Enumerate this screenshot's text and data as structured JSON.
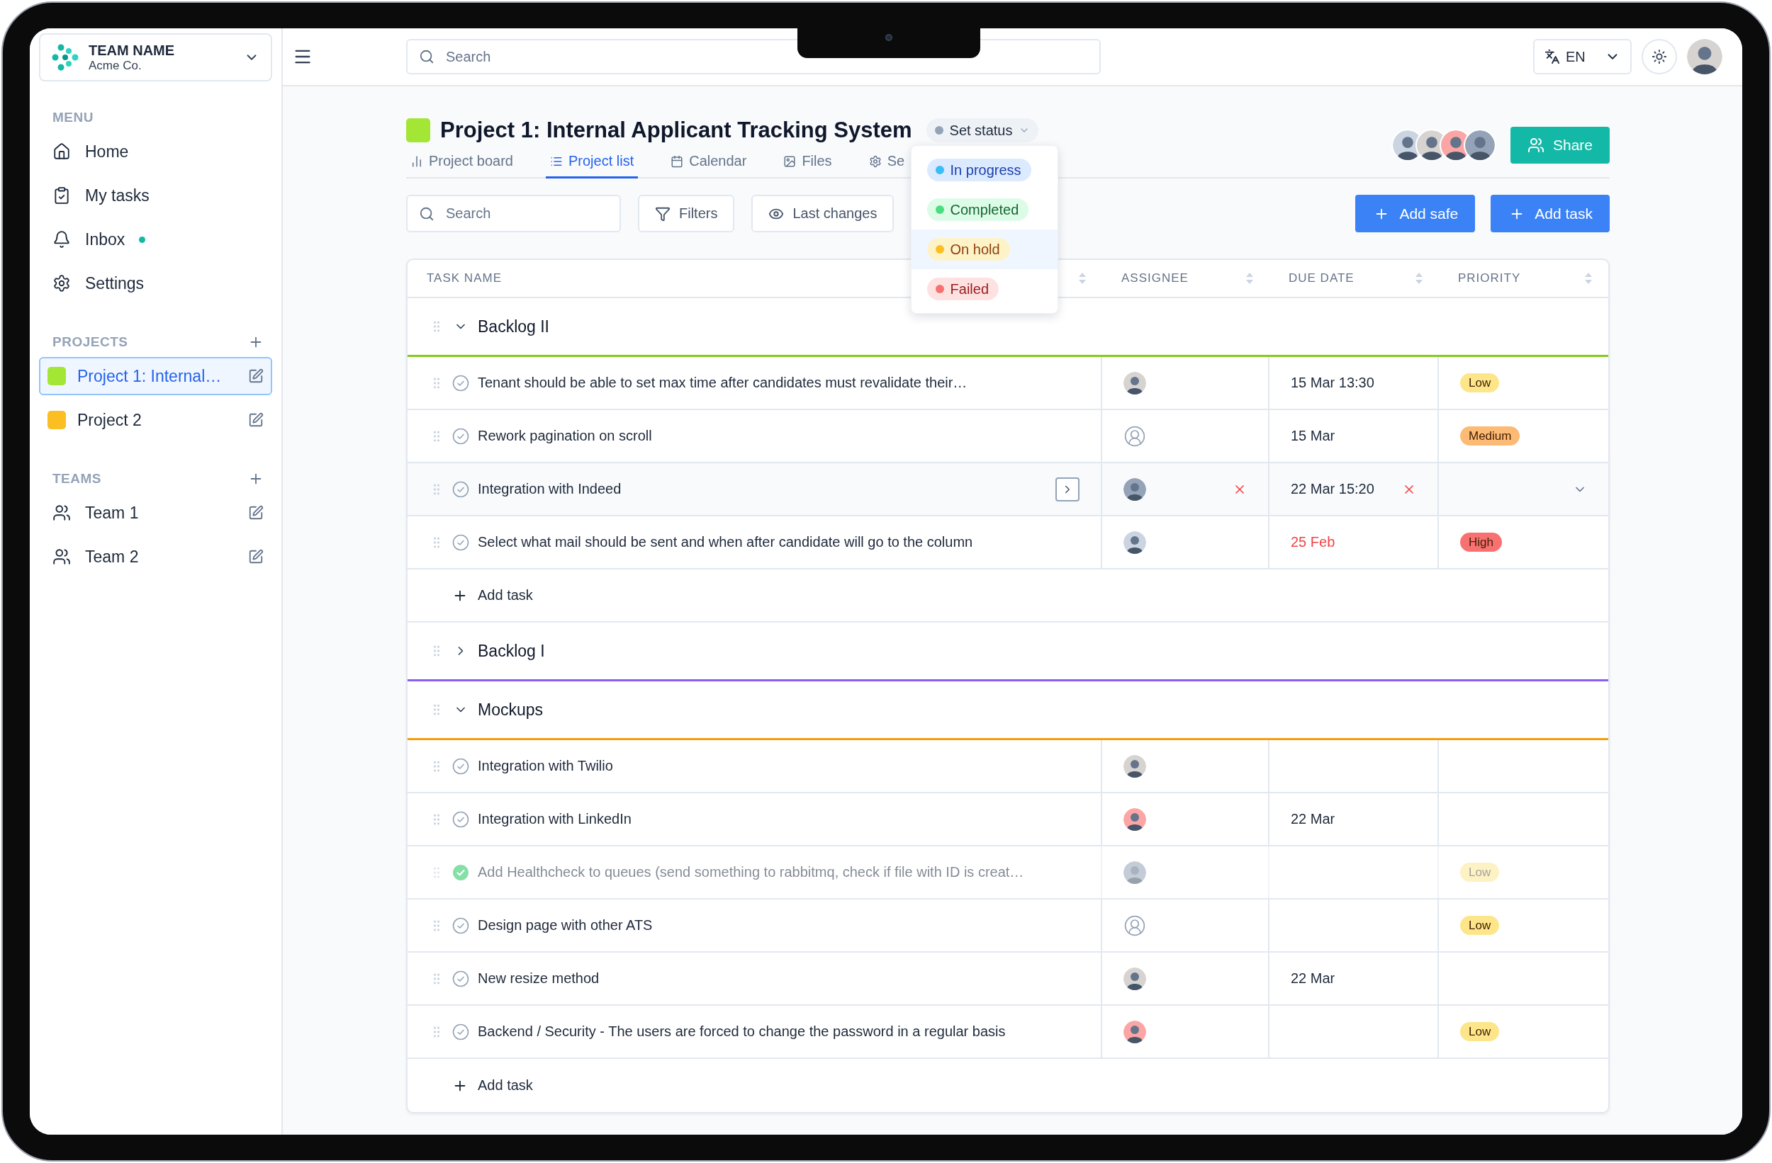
{
  "sidebar": {
    "team": {
      "name": "TEAM NAME",
      "company": "Acme Co."
    },
    "menu": {
      "label": "MENU",
      "items": [
        {
          "label": "Home",
          "kind": "home",
          "unread": false
        },
        {
          "label": "My tasks",
          "kind": "tasks",
          "unread": false
        },
        {
          "label": "Inbox",
          "kind": "inbox",
          "unread": true
        },
        {
          "label": "Settings",
          "kind": "settings",
          "unread": false
        }
      ]
    },
    "projects": {
      "label": "PROJECTS",
      "items": [
        {
          "name": "Project 1: Internal…",
          "color": "#a3e635",
          "selected": true
        },
        {
          "name": "Project 2",
          "color": "#fbbf24",
          "selected": false
        }
      ]
    },
    "teams": {
      "label": "TEAMS",
      "items": [
        {
          "name": "Team 1"
        },
        {
          "name": "Team 2"
        }
      ]
    }
  },
  "topbar": {
    "search": {
      "placeholder": "Search"
    },
    "language": "EN"
  },
  "project": {
    "color": "#a3e635",
    "title": "Project 1: Internal Applicant Tracking System",
    "status": {
      "label": "Set status",
      "color": "#94a3b8",
      "expanded": true,
      "options": [
        {
          "label": "In progress",
          "color": "#38bdf8",
          "highlighted": false
        },
        {
          "label": "Completed",
          "color": "#4ade80",
          "highlighted": false
        },
        {
          "label": "On hold",
          "color": "#fbbf24",
          "highlighted": true
        },
        {
          "label": "Failed",
          "color": "#f87171",
          "highlighted": false
        }
      ]
    },
    "members": [
      {
        "kind": "person"
      },
      {
        "kind": "person"
      },
      {
        "kind": "person"
      },
      {
        "kind": "person"
      }
    ],
    "share": "Share"
  },
  "tabs": [
    {
      "label": "Project board",
      "kind": "board",
      "selected": false
    },
    {
      "label": "Project list",
      "kind": "list",
      "selected": true
    },
    {
      "label": "Calendar",
      "kind": "calendar",
      "selected": false
    },
    {
      "label": "Files",
      "kind": "files",
      "selected": false
    },
    {
      "label": "Se",
      "kind": "settings",
      "selected": false
    }
  ],
  "toolbar": {
    "search": {
      "placeholder": "Search"
    },
    "filters": "Filters",
    "last_changes": "Last changes",
    "add_safe": "Add safe",
    "add_task": "Add task"
  },
  "table": {
    "columns": [
      "TASK NAME",
      "ASSIGNEE",
      "DUE DATE",
      "PRIORITY"
    ],
    "groups": [
      {
        "name": "Backlog II",
        "color": "#84cc16",
        "expanded": true,
        "add_label": "Add task",
        "tasks": [
          {
            "title": "Tenant should be able to set max time after candidates must revalidate their…",
            "done": false,
            "hovered": false,
            "assigned": true,
            "due": "15 Mar 13:30",
            "overdue": false,
            "priority": {
              "label": "Low",
              "color": "#fde68a"
            }
          },
          {
            "title": "Rework pagination on scroll",
            "done": false,
            "hovered": false,
            "assigned": false,
            "due": "15 Mar",
            "overdue": false,
            "priority": {
              "label": "Medium",
              "color": "#fdba74"
            }
          },
          {
            "title": "Integration with Indeed",
            "done": false,
            "hovered": true,
            "assigned": true,
            "due": "22 Mar 15:20",
            "overdue": false
          },
          {
            "title": "Select what mail should be sent and when after candidate will go to the column",
            "done": false,
            "hovered": false,
            "assigned": true,
            "due": "25 Feb",
            "overdue": true,
            "priority": {
              "label": "High",
              "color": "#f87171"
            }
          }
        ]
      },
      {
        "name": "Backlog I",
        "color": "#8b5cf6",
        "expanded": false
      },
      {
        "name": "Mockups",
        "color": "#f59e0b",
        "expanded": true,
        "add_label": "Add task",
        "tasks": [
          {
            "title": "Integration with Twilio",
            "done": false,
            "hovered": false,
            "assigned": true
          },
          {
            "title": "Integration with LinkedIn",
            "done": false,
            "hovered": false,
            "assigned": true,
            "due": "22 Mar",
            "overdue": false
          },
          {
            "title": "Add Healthcheck to queues (send something to rabbitmq, check if file with ID is creat…",
            "done": true,
            "hovered": false,
            "assigned": true,
            "priority": {
              "label": "Low",
              "color": "#fdf2c4"
            }
          },
          {
            "title": "Design page with other ATS",
            "done": false,
            "hovered": false,
            "assigned": false,
            "priority": {
              "label": "Low",
              "color": "#fde68a"
            }
          },
          {
            "title": "New resize method",
            "done": false,
            "hovered": false,
            "assigned": true,
            "due": "22 Mar",
            "overdue": false
          },
          {
            "title": "Backend / Security - The users are forced to change the password in a regular basis",
            "done": false,
            "hovered": false,
            "assigned": true,
            "priority": {
              "label": "Low",
              "color": "#fde68a"
            }
          }
        ]
      }
    ]
  }
}
